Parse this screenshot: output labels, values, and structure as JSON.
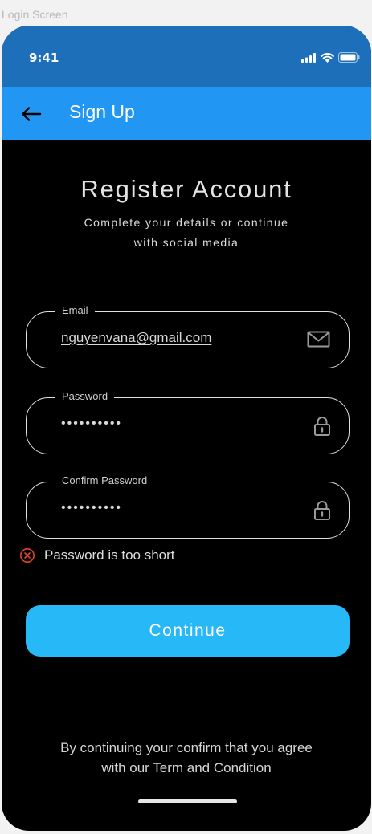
{
  "frame_label": "Login Screen",
  "status_bar": {
    "time": "9:41",
    "icons": [
      "signal-icon",
      "wifi-icon",
      "battery-icon"
    ]
  },
  "app_bar": {
    "title": "Sign Up",
    "back_icon": "arrow-left-icon"
  },
  "header": {
    "title": "Register Account",
    "subtitle_line1": "Complete your details or continue",
    "subtitle_line2": "with social media"
  },
  "form": {
    "email": {
      "label": "Email",
      "value": "nguyenvana@gmail.com",
      "icon": "mail-icon"
    },
    "password": {
      "label": "Password",
      "value": "••••••••••",
      "icon": "lock-icon"
    },
    "confirm_password": {
      "label": "Confirm Password",
      "value": "••••••••••",
      "icon": "lock-icon"
    },
    "error": {
      "text": "Password is too short",
      "icon": "error-circle-icon",
      "color": "#e0432d"
    }
  },
  "continue_button": {
    "label": "Continue",
    "color": "#27b8f8"
  },
  "footer": {
    "line1": "By continuing your confirm that you agree",
    "line2": "with our Term and Condition"
  },
  "colors": {
    "status_bar": "#1c6fb8",
    "app_bar": "#2196f3",
    "background": "#000000"
  }
}
